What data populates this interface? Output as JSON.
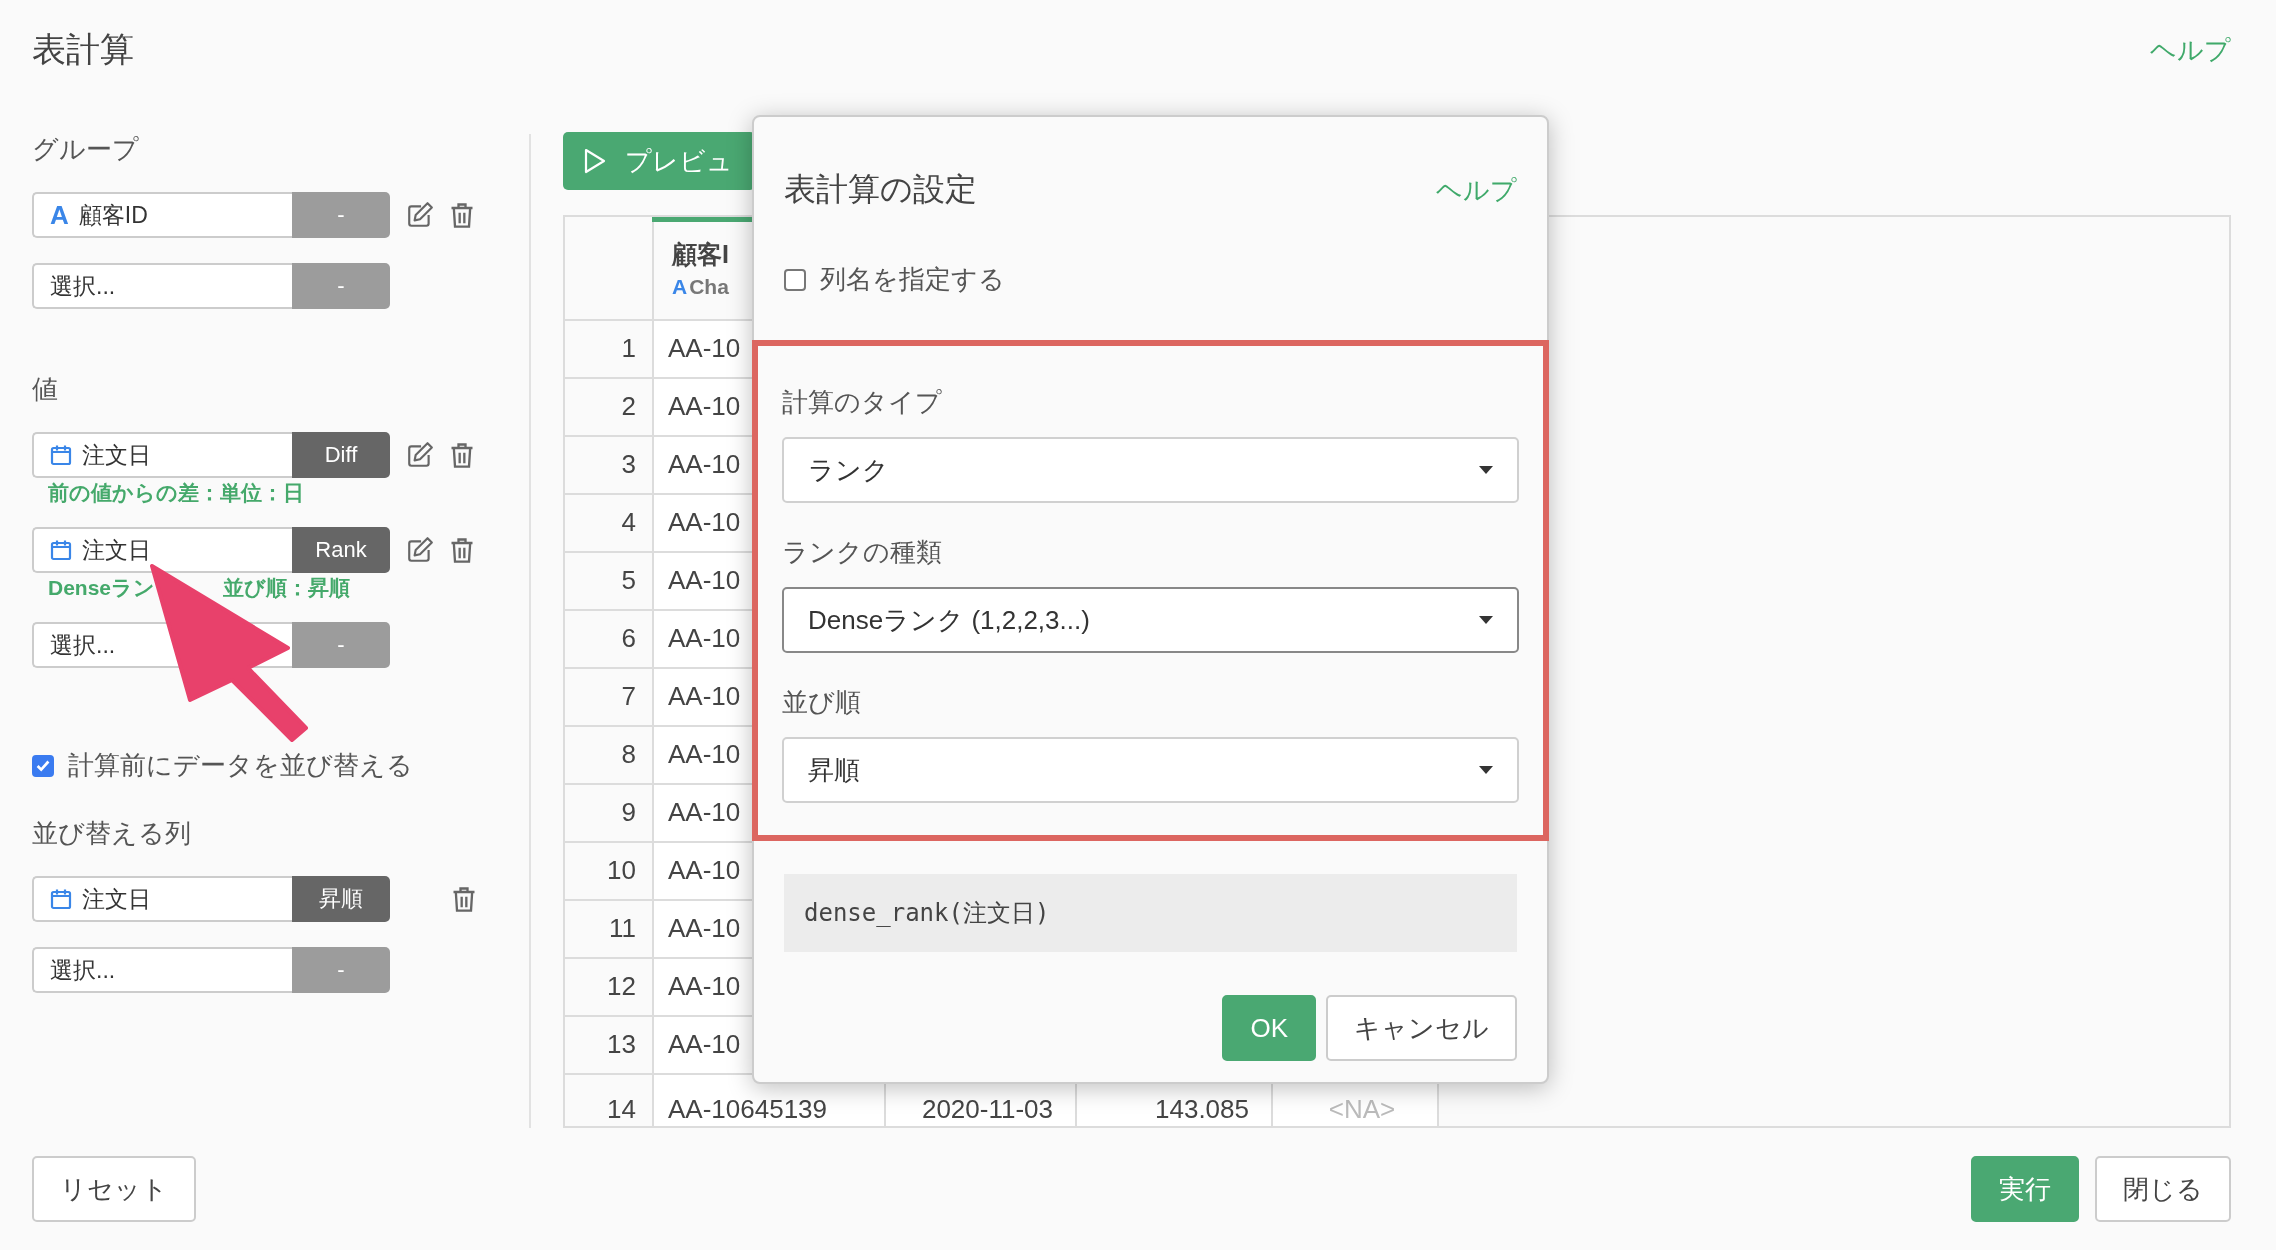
{
  "title": "表計算",
  "help_link": "ヘルプ",
  "sections": [
    {
      "heading": "グループ",
      "items": [
        {
          "kind": "column",
          "type_mark": "A",
          "name": "顧客ID",
          "tag": "-",
          "tag_filled": false,
          "editable": true,
          "deletable": true
        },
        {
          "kind": "empty",
          "placeholder": "選択...",
          "tag": "-",
          "tag_filled": false,
          "editable": false,
          "deletable": false
        }
      ]
    },
    {
      "heading": "値",
      "items": [
        {
          "kind": "date",
          "name": "注文日",
          "tag": "Diff",
          "tag_filled": true,
          "editable": true,
          "deletable": true,
          "note": [
            "前の値からの差：単位：日"
          ]
        },
        {
          "kind": "date",
          "name": "注文日",
          "tag": "Rank",
          "tag_filled": true,
          "editable": true,
          "deletable": true,
          "note": [
            "Denseラン",
            "並び順：昇順"
          ]
        },
        {
          "kind": "empty",
          "placeholder": "選択...",
          "tag": "-",
          "tag_filled": false,
          "editable": false,
          "deletable": false
        }
      ]
    },
    {
      "checkbox": {
        "label": "計算前にデータを並び替える",
        "checked": true
      },
      "heading": "並び替える列",
      "items": [
        {
          "kind": "date",
          "name": "注文日",
          "tag": "昇順",
          "tag_filled": true,
          "editable": false,
          "deletable": true
        },
        {
          "kind": "empty",
          "placeholder": "選択...",
          "tag": "-",
          "tag_filled": false,
          "editable": false,
          "deletable": false
        }
      ]
    }
  ],
  "preview_button": "プレビュ",
  "table": {
    "columns": [
      {
        "name": "顧客I",
        "type_mark": "A",
        "type": "Cha",
        "selected": true
      }
    ],
    "rows": [
      {
        "number": "1",
        "cells": [
          "AA-10"
        ]
      },
      {
        "number": "2",
        "cells": [
          "AA-10"
        ]
      },
      {
        "number": "3",
        "cells": [
          "AA-10"
        ]
      },
      {
        "number": "4",
        "cells": [
          "AA-10"
        ]
      },
      {
        "number": "5",
        "cells": [
          "AA-10"
        ]
      },
      {
        "number": "6",
        "cells": [
          "AA-10"
        ]
      },
      {
        "number": "7",
        "cells": [
          "AA-10"
        ]
      },
      {
        "number": "8",
        "cells": [
          "AA-10"
        ]
      },
      {
        "number": "9",
        "cells": [
          "AA-10"
        ]
      },
      {
        "number": "10",
        "cells": [
          "AA-10"
        ]
      },
      {
        "number": "11",
        "cells": [
          "AA-10"
        ]
      },
      {
        "number": "12",
        "cells": [
          "AA-10"
        ]
      },
      {
        "number": "13",
        "cells": [
          "AA-10"
        ]
      },
      {
        "number": "14",
        "cells": [
          "AA-10645139",
          "2020-11-03",
          "143.085"
        ],
        "na_cell": "<NA>"
      }
    ]
  },
  "dialog": {
    "title": "表計算の設定",
    "help_link": "ヘルプ",
    "name_checkbox": {
      "label": "列名を指定する",
      "checked": false
    },
    "highlighted": true,
    "fields": [
      {
        "label": "計算のタイプ",
        "value": "ランク",
        "focused": false
      },
      {
        "label": "ランクの種類",
        "value": "Denseランク (1,2,2,3...)",
        "focused": true
      },
      {
        "label": "並び順",
        "value": "昇順",
        "focused": false
      }
    ],
    "expression": "dense_rank(注文日)",
    "buttons": [
      {
        "label": "OK",
        "primary": true
      },
      {
        "label": "キャンセル",
        "primary": false
      }
    ]
  },
  "footer": {
    "left_buttons": [
      {
        "label": "リセット",
        "primary": false
      }
    ],
    "right_buttons": [
      {
        "label": "実行",
        "primary": true
      },
      {
        "label": "閉じる",
        "primary": false
      }
    ]
  }
}
